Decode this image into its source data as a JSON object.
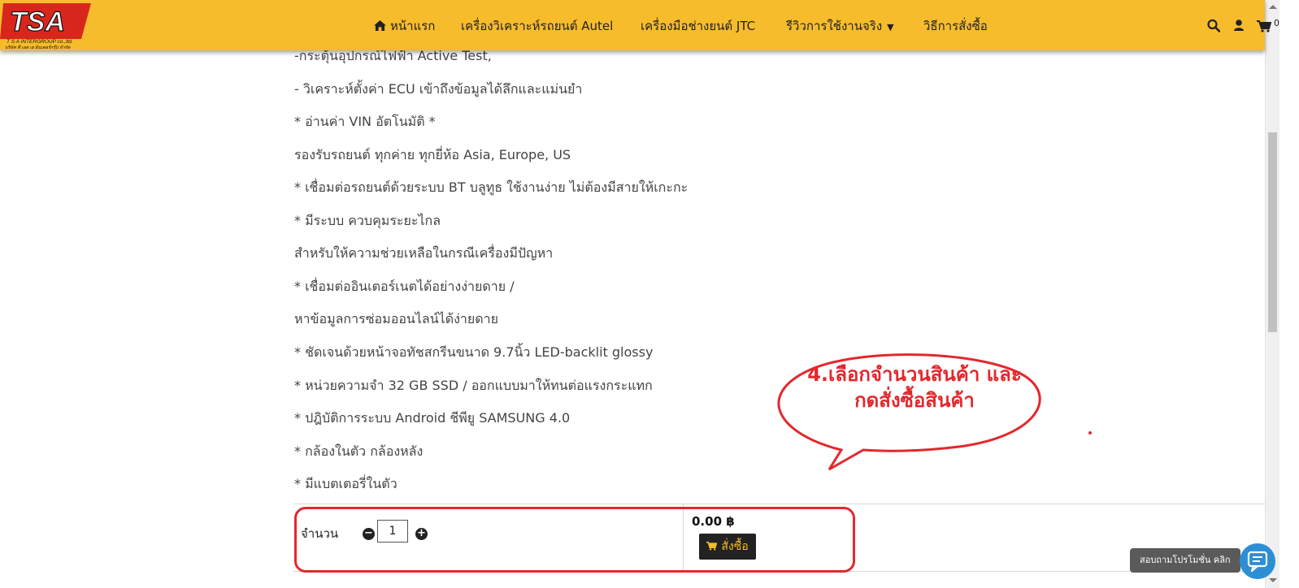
{
  "header": {
    "logo_text": "TSA",
    "logo_sub1": "T S A INTERGROUP co.,ltd.",
    "logo_sub2": "บริษัท ที เอส เอ อินเตอร์กรุ๊ป จำกัด",
    "nav": [
      {
        "label": "หน้าแรก",
        "icon": "home-icon"
      },
      {
        "label": "เครื่องวิเคราะห์รถยนต์ Autel"
      },
      {
        "label": "เครื่องมือช่างยนต์ JTC"
      },
      {
        "label": "รีวิวการใช้งานจริง",
        "has_dropdown": true
      },
      {
        "label": "วิธีการสั่งซื้อ"
      }
    ],
    "icons": [
      "search-icon",
      "user-icon",
      "cart-icon"
    ],
    "cart_count": "0",
    "accent_color": "#f7bc2b"
  },
  "description": [
    "-กระตุ้นอุปกรณ์ไฟฟ้า Active Test,",
    "- วิเคราะห์ตั้งค่า ECU เข้าถึงข้อมูลได้ลึกและแม่นยำ",
    "* อ่านค่า VIN อัตโนมัติ *",
    "รองรับรถยนต์ ทุกค่าย ทุกยี่ห้อ Asia, Europe, US",
    "* เชื่อมต่อรถยนต์ด้วยระบบ BT บลูทูธ ใช้งานง่าย ไม่ต้องมีสายให้เกะกะ",
    " * มีระบบ ควบคุมระยะไกล",
    " สำหรับให้ความช่วยเหลือในกรณีเครื่องมีปัญหา",
    "* เชื่อมต่ออินเตอร์เนตได้อย่างง่ายดาย /",
    " หาข้อมูลการซ่อมออนไลน์ได้ง่ายดาย",
    " * ชัดเจนด้วยหน้าจอทัชสกรีนขนาด 9.7นิ้ว LED-backlit glossy",
    "* หน่วยความจำ 32 GB SSD / ออกแบบมาให้ทนต่อแรงกระแทก",
    "* ปฎิบัติการระบบ Android ชีพียู SAMSUNG 4.0",
    "* กล้องในตัว กล้องหลัง",
    "* มีแบตเตอรี่ในตัว"
  ],
  "order": {
    "qty_label": "จำนวน",
    "qty_value": "1",
    "minus": "−",
    "plus": "+",
    "price": "0.00 ฿",
    "buy_label": "สั่งซื้อ"
  },
  "annotation": {
    "line1": "4.เลือกจำนวนสินค้า และ",
    "line2": "กดสั่งซื้อสินค้า",
    "color": "#e3282d"
  },
  "chat": {
    "tooltip": "สอบถามโปรโมชั่น คลิก",
    "color": "#2c8fd6"
  }
}
